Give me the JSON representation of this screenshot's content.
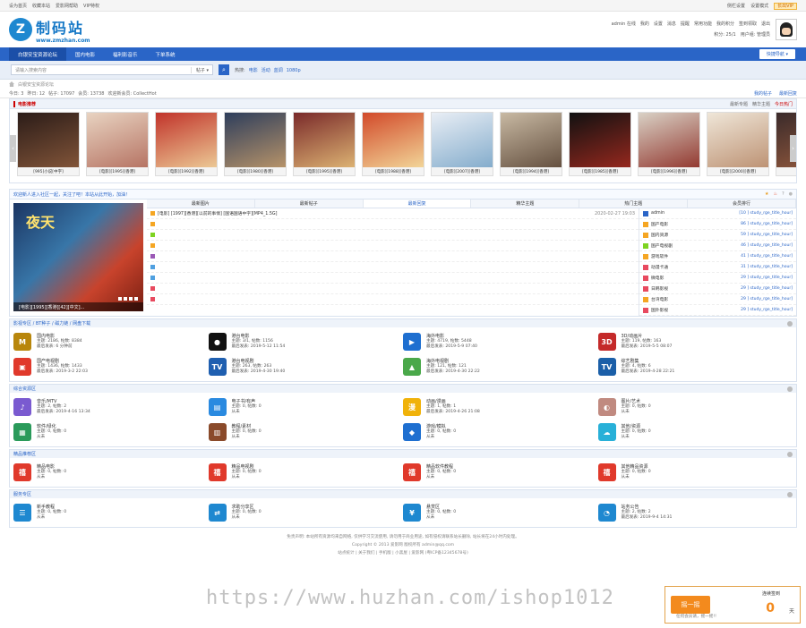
{
  "topbar": {
    "left": [
      "设为首页",
      "收藏本站",
      "爱影网帮助",
      "VIP特权"
    ],
    "right": [
      "侧栏设置",
      "设置模式"
    ],
    "badge": "长出VIP"
  },
  "brand": {
    "name": "制码站",
    "url": "www.zmzhan.com",
    "mark": "Z"
  },
  "user": {
    "line1": [
      "admin 在线",
      "我的",
      "设置",
      "消息",
      "提醒",
      "常用功能",
      "我的积分",
      "签到领取",
      "退出"
    ],
    "line2": [
      "积分: 25/1",
      "用户组: 管理员"
    ]
  },
  "nav": {
    "items": [
      "白银安宝资源论坛",
      "国内电影",
      "福利影音乐",
      "下单系统"
    ],
    "quick": "快捷导航"
  },
  "search": {
    "placeholder": "请输入搜索内容",
    "scope": "帖子",
    "hot_label": "热搜:",
    "hot": [
      "电影",
      "活动",
      "蓝调",
      "1080p"
    ]
  },
  "crumb": "白银安宝资源论坛",
  "stats": {
    "left": [
      "今日: 3",
      "昨日: 12",
      "帖子: 17097",
      "会员: 13738",
      "欢迎新会员: CollectHot"
    ],
    "right": [
      "我的帖子",
      "最新回复"
    ]
  },
  "movies": {
    "title": "电影推荐",
    "right": [
      "最新专题",
      "精华主题",
      "今日热门"
    ],
    "posters": [
      {
        "cap": "[995]小说[中字]",
        "c1": "#2b1c18",
        "c2": "#8a5a3c"
      },
      {
        "cap": "[电影][1995][香港]",
        "c1": "#e8d3c1",
        "c2": "#b16a5a"
      },
      {
        "cap": "[电影][1992][香港]",
        "c1": "#c1332a",
        "c2": "#f0d8a0"
      },
      {
        "cap": "[电影][1980][香港]",
        "c1": "#2e3e5c",
        "c2": "#c49b6a"
      },
      {
        "cap": "[电影][1995][香港]",
        "c1": "#7a2a2a",
        "c2": "#e6c07a"
      },
      {
        "cap": "[电影][1988][香港]",
        "c1": "#d24a2a",
        "c2": "#f5e3a3"
      },
      {
        "cap": "[电影][2007][香港]",
        "c1": "#e9eef5",
        "c2": "#7aa6c8"
      },
      {
        "cap": "[电影][1994][香港]",
        "c1": "#c8b9a3",
        "c2": "#5b4636"
      },
      {
        "cap": "[电影][1985][香港]",
        "c1": "#111111",
        "c2": "#a32a1f"
      },
      {
        "cap": "[电影][1996][香港]",
        "c1": "#d9d1c5",
        "c2": "#8c2a22"
      },
      {
        "cap": "[电影][2000][香港]",
        "c1": "#efe6d8",
        "c2": "#b88a6a"
      },
      {
        "cap": "",
        "c1": "#3a2a2a",
        "c2": "#a06040"
      }
    ]
  },
  "notice": "欢迎新人进入社区一起，关注了吧！本站从此开始，加油！",
  "hot": {
    "poster_title": "夜天",
    "poster_cap": "[电影][1995][香港][42][中文]...",
    "tabs": [
      "最新图片",
      "最新帖子",
      "最新回复",
      "精华主题",
      "热门主题",
      "会员排行"
    ],
    "rows": [
      {
        "text": "[电影] [1997][香港][以前的事情] [国语国语中字][MP4_1.5G]",
        "date": "2020-02-27 19:03",
        "color": "#f5a623"
      },
      {
        "text": "",
        "date": "",
        "color": "#f5a623"
      },
      {
        "text": "",
        "date": "",
        "color": "#7ed321"
      },
      {
        "text": "",
        "date": "",
        "color": "#f5a623"
      },
      {
        "text": "",
        "date": "",
        "color": "#9b59b6"
      },
      {
        "text": "",
        "date": "",
        "color": "#50a0e0"
      },
      {
        "text": "",
        "date": "",
        "color": "#50a0e0"
      },
      {
        "text": "",
        "date": "",
        "color": "#e84a5f"
      },
      {
        "text": "",
        "date": "",
        "color": "#e84a5f"
      }
    ],
    "rank": [
      {
        "name": "admin",
        "val": "[10 ] study_rge_title_hour]",
        "color": "#2a65c7"
      },
      {
        "name": "国产电影",
        "val": "86 ] study_rge_title_hour]",
        "color": "#f5a623"
      },
      {
        "name": "国内资源",
        "val": "59 ] study_rge_title_hour]",
        "color": "#f5a623"
      },
      {
        "name": "国产电视剧",
        "val": "46 ] study_rge_title_hour]",
        "color": "#7ed321"
      },
      {
        "name": "游戏软件",
        "val": "41 ] study_rge_title_hour]",
        "color": "#f5a623"
      },
      {
        "name": "动漫卡通",
        "val": "31 ] study_rge_title_hour]",
        "color": "#e84a5f"
      },
      {
        "name": "微电影",
        "val": "29 ] study_rge_title_hour]",
        "color": "#e84a5f"
      },
      {
        "name": "日韩影视",
        "val": "29 ] study_rge_title_hour]",
        "color": "#e84a5f"
      },
      {
        "name": "台湾电影",
        "val": "29 ] study_rge_title_hour]",
        "color": "#f5a623"
      },
      {
        "name": "国外影视",
        "val": "29 ] study_rge_title_hour]",
        "color": "#e84a5f"
      }
    ]
  },
  "sections": [
    {
      "title": "影视专区 / BT种子 / 磁力链 / 网盘下载",
      "forums": [
        {
          "name": "国内电影",
          "l1": "主题: 2186, 帖数: 8384",
          "l2": "最后发表: 6 分钟前",
          "bg": "#b8860b",
          "g": "M"
        },
        {
          "name": "港台电影",
          "l1": "主题: 3/1, 帖数: 1156",
          "l2": "最后发表: 2019-5-12 11:54",
          "bg": "#111111",
          "g": "●"
        },
        {
          "name": "海外电影",
          "l1": "主题: 4719, 帖数: 5448",
          "l2": "最后发表: 2019-5-9 07:40",
          "bg": "#1e6fd0",
          "g": "▶"
        },
        {
          "name": "3D/动画片",
          "l1": "主题: 119, 帖数: 163",
          "l2": "最后发表: 2019-5-5 08:07",
          "bg": "#c42a2a",
          "g": "3D"
        },
        {
          "name": "国产电视剧",
          "l1": "主题: 1436, 帖数: 1433",
          "l2": "最后发表: 2019-3-2 22:03",
          "bg": "#e0392b",
          "g": "▣"
        },
        {
          "name": "港台电视剧",
          "l1": "主题: 263, 帖数: 263",
          "l2": "最后发表: 2019-4-30 19:40",
          "bg": "#1f5fb0",
          "g": "TV"
        },
        {
          "name": "海外电视剧",
          "l1": "主题: 121, 帖数: 121",
          "l2": "最后发表: 2019-4-30 22:22",
          "bg": "#4aa84a",
          "g": "▲"
        },
        {
          "name": "综艺剧集",
          "l1": "主题: 4, 帖数: 6",
          "l2": "最后发表: 2019-4-28 22:21",
          "bg": "#1b5fa8",
          "g": "TV"
        }
      ]
    },
    {
      "title": "综合资源区",
      "forums": [
        {
          "name": "音乐/MTV",
          "l1": "主题: 2, 帖数: 2",
          "l2": "最后发表: 2019-4-16 13:34",
          "bg": "#7a5ad0",
          "g": "♪"
        },
        {
          "name": "电子书/有声",
          "l1": "主题: 0, 帖数: 0",
          "l2": "从未",
          "bg": "#2a8ae0",
          "g": "▤"
        },
        {
          "name": "动画/漫画",
          "l1": "主题: 1, 帖数: 1",
          "l2": "最后发表: 2019-4-26 21:08",
          "bg": "#f0b20a",
          "g": "漫"
        },
        {
          "name": "图片/艺术",
          "l1": "主题: 0, 帖数: 0",
          "l2": "从未",
          "bg": "#c08a80",
          "g": "◐"
        },
        {
          "name": "软件/绿化",
          "l1": "主题: 0, 帖数: 0",
          "l2": "从未",
          "bg": "#2a9a5a",
          "g": "▦"
        },
        {
          "name": "教程/素材",
          "l1": "主题: 0, 帖数: 0",
          "l2": "从未",
          "bg": "#8a4a2a",
          "g": "▥"
        },
        {
          "name": "游戏/模拟",
          "l1": "主题: 0, 帖数: 0",
          "l2": "从未",
          "bg": "#1e6fd0",
          "g": "◆"
        },
        {
          "name": "其他/资源",
          "l1": "主题: 0, 帖数: 0",
          "l2": "从未",
          "bg": "#28b0d8",
          "g": "☁"
        }
      ]
    },
    {
      "title": "精品推荐区",
      "forums": [
        {
          "name": "精品电影",
          "l1": "主题: 0, 帖数: 0",
          "l2": "从未",
          "bg": "#e0392b",
          "g": "禧"
        },
        {
          "name": "精品电视剧",
          "l1": "主题: 0, 帖数: 0",
          "l2": "从未",
          "bg": "#e0392b",
          "g": "禧"
        },
        {
          "name": "精品软件教程",
          "l1": "主题: 0, 帖数: 0",
          "l2": "从未",
          "bg": "#e0392b",
          "g": "禧"
        },
        {
          "name": "其他精品资源",
          "l1": "主题: 0, 帖数: 0",
          "l2": "从未",
          "bg": "#e0392b",
          "g": "禧"
        }
      ]
    },
    {
      "title": "服务专区",
      "forums": [
        {
          "name": "新手教程",
          "l1": "主题: 0, 帖数: 0",
          "l2": "从未",
          "bg": "#1e88d0",
          "g": "☰"
        },
        {
          "name": "求助分享区",
          "l1": "主题: 0, 帖数: 0",
          "l2": "从未",
          "bg": "#1e88d0",
          "g": "⇄"
        },
        {
          "name": "悬赏区",
          "l1": "主题: 0, 帖数: 0",
          "l2": "从未",
          "bg": "#1e88d0",
          "g": "¥"
        },
        {
          "name": "站务公告",
          "l1": "主题: 2, 帖数: 2",
          "l2": "最后发表: 2019-9-4 14:31",
          "bg": "#1e88d0",
          "g": "◔"
        }
      ]
    }
  ],
  "footer": {
    "l1": "免责声明: 本站所有资源均来自网络, 仅供学习交流使用, 请勿用于商业用途, 如有侵权请联系站长删除, 站长将在24小时内处理。",
    "l2": "Copyright © 2013 爱影网 版权所有 admin@qq.com",
    "l3": "站点统计 | 关于我们 | 手机版 | 小黑屋 | 爱影网 (粤ICP备12345678号)"
  },
  "watermark": "https://www.huzhan.com/ishop1012",
  "shake": {
    "btn": "摇一摇",
    "label": "连续签到",
    "count": "0",
    "unit": "天",
    "sub": "任何会员请，摇一摇!!"
  }
}
